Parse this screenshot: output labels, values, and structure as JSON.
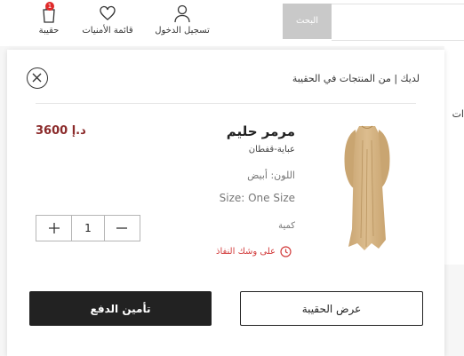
{
  "header": {
    "bag_label": "حقيبة",
    "bag_badge": "1",
    "wishlist_label": "قائمة الأمنيات",
    "login_label": "تسجيل الدخول",
    "search_button_label": "البحث",
    "search_placeholder": ""
  },
  "background": {
    "partial_text": "ات"
  },
  "cart": {
    "heading": "لديك | من المنتجات في الحقيبة",
    "item": {
      "name": "مرمر حليم",
      "subtitle": "عباية-قفطان",
      "color": "اللون: أبيض",
      "size": "Size: One Size",
      "quantity_label": "كمية",
      "quantity": "1",
      "low_stock": "على وشك النفاذ",
      "price": "3600 د.إ",
      "image_color": "#d9b989"
    },
    "checkout_label": "تأمين الدفع",
    "view_bag_label": "عرض الحقيبة"
  },
  "colors": {
    "accent_price": "#8b2a2a",
    "warning": "#d23b3b",
    "primary_button": "#222222",
    "badge": "#e02a2a"
  }
}
